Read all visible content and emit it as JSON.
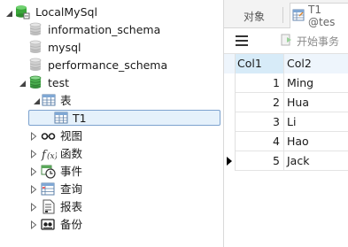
{
  "tree": {
    "connection": "LocalMySql",
    "databases": [
      {
        "name": "information_schema"
      },
      {
        "name": "mysql"
      },
      {
        "name": "performance_schema"
      },
      {
        "name": "test"
      }
    ],
    "tables_folder": "表",
    "selected_table": "T1",
    "folders": [
      {
        "name": "视图",
        "icon": "view-glasses-icon"
      },
      {
        "name": "函数",
        "icon": "function-icon"
      },
      {
        "name": "事件",
        "icon": "event-clock-icon"
      },
      {
        "name": "查询",
        "icon": "query-icon"
      },
      {
        "name": "报表",
        "icon": "report-icon"
      },
      {
        "name": "备份",
        "icon": "backup-icon"
      }
    ]
  },
  "tabs": {
    "objects": "对象",
    "t1": "T1 @tes"
  },
  "toolbar": {
    "begin_transaction": "开始事务"
  },
  "grid": {
    "columns": [
      "Col1",
      "Col2"
    ],
    "rows": [
      {
        "col1": "1",
        "col2": "Ming"
      },
      {
        "col1": "2",
        "col2": "Hua"
      },
      {
        "col1": "3",
        "col2": "Li"
      },
      {
        "col1": "4",
        "col2": "Hao"
      },
      {
        "col1": "5",
        "col2": "Jack"
      }
    ]
  },
  "colors": {
    "connection_green": "#3aa63a",
    "database_gray": "#c8c8c8",
    "database_green": "#4caf50",
    "selection_bg": "#e5f1fb",
    "selection_border": "#7da2ce",
    "header_blue": "#d7ebf8"
  }
}
